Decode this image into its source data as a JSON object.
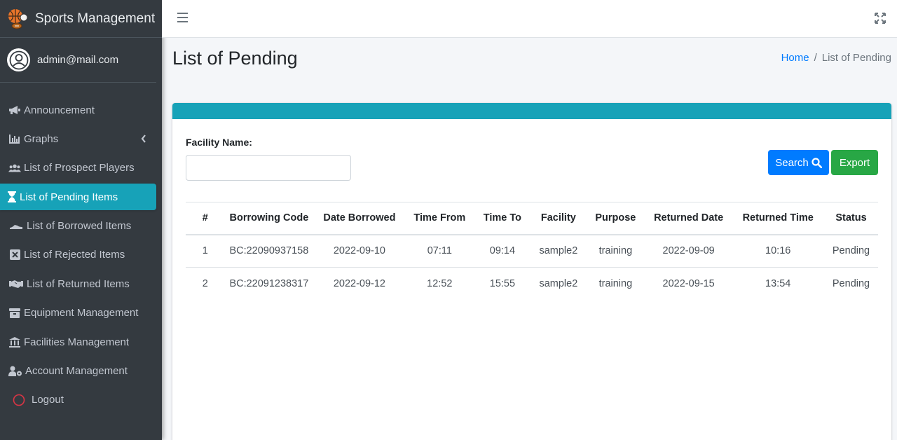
{
  "app": {
    "title": "Sports Management"
  },
  "user": {
    "email": "admin@mail.com"
  },
  "sidebar": {
    "items": [
      {
        "label": "Announcement",
        "icon": "megaphone-icon"
      },
      {
        "label": "Graphs",
        "icon": "chart-icon"
      },
      {
        "label": "List of Prospect Players",
        "icon": "users-icon"
      },
      {
        "label": "List of Pending Items",
        "icon": "hourglass-icon"
      },
      {
        "label": "List of Borrowed Items",
        "icon": "shoe-icon"
      },
      {
        "label": "List of Rejected Items",
        "icon": "x-square-icon"
      },
      {
        "label": "List of Returned Items",
        "icon": "handshake-icon"
      },
      {
        "label": "Equipment Management",
        "icon": "box-icon"
      },
      {
        "label": "Facilities Management",
        "icon": "building-icon"
      },
      {
        "label": "Account Management",
        "icon": "user-cog-icon"
      },
      {
        "label": "Logout",
        "icon": "circle-icon"
      }
    ]
  },
  "header": {
    "page_title": "List of Pending"
  },
  "breadcrumb": {
    "home": "Home",
    "separator": "/",
    "current": "List of Pending"
  },
  "filter": {
    "label": "Facility Name:",
    "value": ""
  },
  "buttons": {
    "search": "Search",
    "export": "Export"
  },
  "table": {
    "headers": [
      "#",
      "Borrowing Code",
      "Date Borrowed",
      "Time From",
      "Time To",
      "Facility",
      "Purpose",
      "Returned Date",
      "Returned Time",
      "Status"
    ],
    "rows": [
      [
        "1",
        "BC:22090937158",
        "2022-09-10",
        "07:11",
        "09:14",
        "sample2",
        "training",
        "2022-09-09",
        "10:16",
        "Pending"
      ],
      [
        "2",
        "BC:22091238317",
        "2022-09-12",
        "12:52",
        "15:55",
        "sample2",
        "training",
        "2022-09-15",
        "13:54",
        "Pending"
      ]
    ]
  },
  "colors": {
    "sidebar": "#343a40",
    "active": "#17a2b8",
    "search": "#007bff",
    "export": "#28a745",
    "link": "#007bff"
  }
}
